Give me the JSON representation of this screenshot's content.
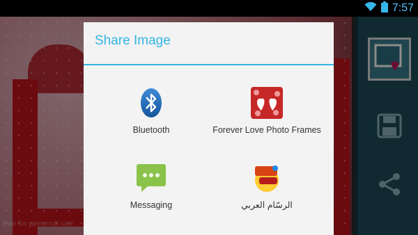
{
  "status_bar": {
    "time": "7:57",
    "icons": [
      "wifi-icon",
      "battery-icon"
    ]
  },
  "background_app": {
    "watermark": "free for personal use",
    "sidebar_buttons": [
      "frame-icon",
      "save-icon",
      "share-icon"
    ]
  },
  "dialog": {
    "title": "Share Image",
    "apps": [
      {
        "label": "Bluetooth",
        "icon": "bluetooth-icon"
      },
      {
        "label": "Forever Love Photo Frames",
        "icon": "forever-love-app-icon"
      },
      {
        "label": "Messaging",
        "icon": "messaging-icon"
      },
      {
        "label": "الرسّام العربي",
        "icon": "arabic-painter-app-icon"
      }
    ]
  },
  "colors": {
    "accent": "#33b5e5",
    "dialog_bg": "#f3f3f3",
    "statusbar_bg": "#000000"
  }
}
